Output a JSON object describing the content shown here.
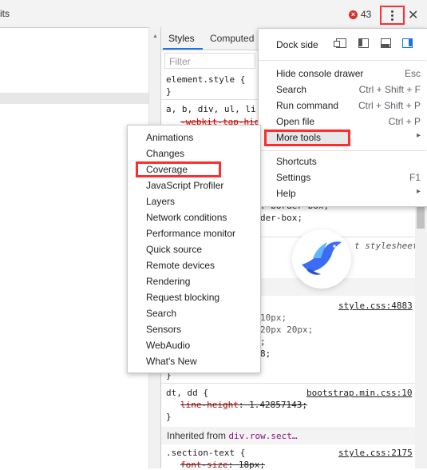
{
  "topbar": {
    "tab_fragment": "its",
    "error_count": "43",
    "error_icon_glyph": "×",
    "close_glyph": "✕"
  },
  "styles_pane": {
    "tabs": [
      "Styles",
      "Computed"
    ],
    "filter_placeholder": "Filter",
    "lines": {
      "element_style": "element.style {",
      "element_style_close": "}",
      "selector_a": "a, b, div, ul, li",
      "webkit_tap": "-webkit-tap-hig",
      "border_box_1": ": border-box;",
      "border_box_2": "der-box;",
      "stylesheet_note": "t stylesheet",
      "style_link": "style.css:4883",
      "val_10px": "10px;",
      "val_20px": "20px 20px;",
      "val_semicolon": ";",
      "val_8": "8;",
      "close_brace_1": "}",
      "dt_dd": "dt, dd {",
      "bootstrap_link": "bootstrap.min.css:10",
      "line_height_prop": "line-height",
      "line_height_val": ": 1.42857143;",
      "close_brace_2": "}",
      "inherited_label": "Inherited from",
      "inherited_selector": "div.row.sect…",
      "section_text": ".section-text {",
      "section_link": "style.css:2175",
      "font_size_prop": "font-size",
      "font_size_val": ": 18px;"
    }
  },
  "main_menu": {
    "dock_side_label": "Dock side",
    "items": [
      {
        "label": "Hide console drawer",
        "shortcut": "Esc"
      },
      {
        "label": "Search",
        "shortcut": "Ctrl + Shift + F"
      },
      {
        "label": "Run command",
        "shortcut": "Ctrl + Shift + P"
      },
      {
        "label": "Open file",
        "shortcut": "Ctrl + P"
      },
      {
        "label": "More tools",
        "shortcut": "▸"
      },
      {
        "label": "Shortcuts",
        "shortcut": ""
      },
      {
        "label": "Settings",
        "shortcut": "F1"
      },
      {
        "label": "Help",
        "shortcut": "▸"
      }
    ]
  },
  "sub_menu": {
    "items": [
      "Animations",
      "Changes",
      "Coverage",
      "JavaScript Profiler",
      "Layers",
      "Network conditions",
      "Performance monitor",
      "Quick source",
      "Remote devices",
      "Rendering",
      "Request blocking",
      "Search",
      "Sensors",
      "WebAudio",
      "What's New"
    ]
  },
  "colors": {
    "highlight_red": "#ff2d2d",
    "accent_blue": "#1a73e8",
    "error_red": "#d93025",
    "logo_blue": "#3b6cf6"
  }
}
